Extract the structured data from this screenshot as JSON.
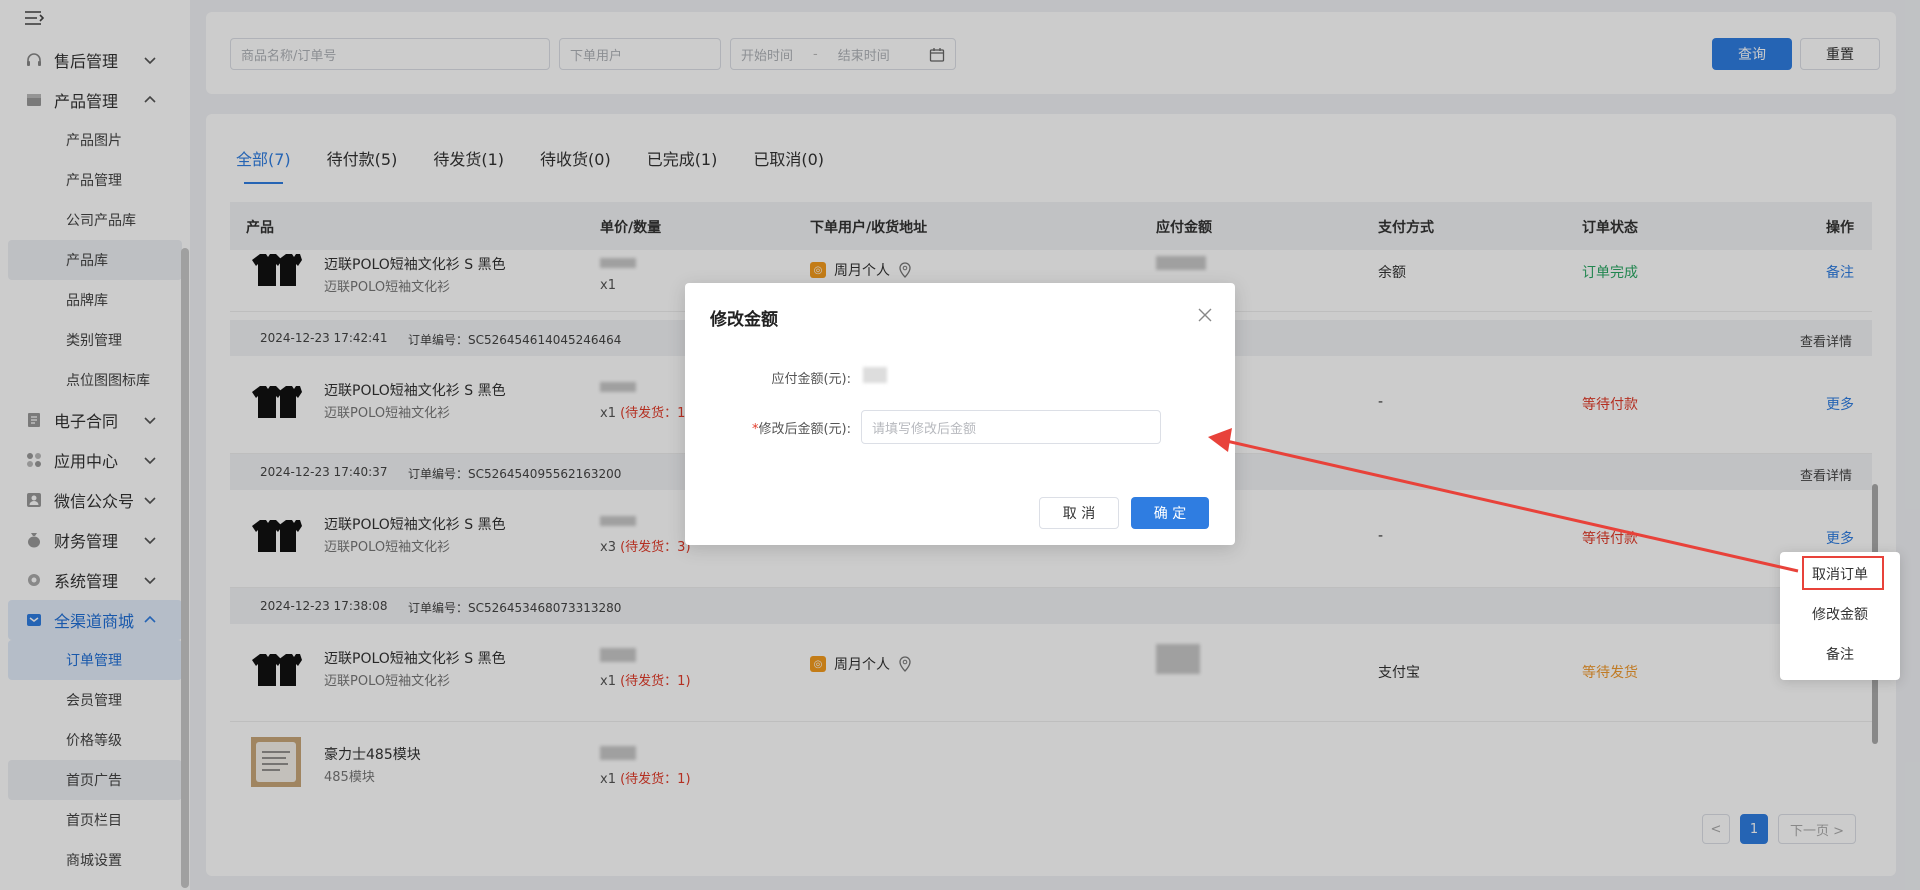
{
  "sidebar": {
    "items": [
      {
        "label": "售后管理",
        "expanded": false
      },
      {
        "label": "产品管理",
        "expanded": true
      },
      {
        "label": "电子合同",
        "expanded": false
      },
      {
        "label": "应用中心",
        "expanded": false
      },
      {
        "label": "微信公众号",
        "expanded": false
      },
      {
        "label": "财务管理",
        "expanded": false
      },
      {
        "label": "系统管理",
        "expanded": false
      },
      {
        "label": "全渠道商城",
        "expanded": true
      }
    ],
    "product_sub": [
      "产品图片",
      "产品管理",
      "公司产品库",
      "产品库",
      "品牌库",
      "类别管理",
      "点位图图标库"
    ],
    "mall_sub": [
      "订单管理",
      "会员管理",
      "价格等级",
      "首页广告",
      "首页栏目",
      "商城设置"
    ]
  },
  "filter": {
    "product_placeholder": "商品名称/订单号",
    "user_placeholder": "下单用户",
    "start_placeholder": "开始时间",
    "date_sep": "-",
    "end_placeholder": "结束时间",
    "query_label": "查询",
    "reset_label": "重置"
  },
  "tabs": [
    "全部(7)",
    "待付款(5)",
    "待发货(1)",
    "待收货(0)",
    "已完成(1)",
    "已取消(0)"
  ],
  "table": {
    "columns": [
      "产品",
      "单价/数量",
      "下单用户/收货地址",
      "应付金额",
      "支付方式",
      "订单状态",
      "操作"
    ],
    "detail_label": "查看详情",
    "orders": [
      {
        "date": "",
        "no": "",
        "product": "迈联POLO短袖文化衫 S 黑色",
        "product_sub": "迈联POLO短袖文化衫",
        "qty": "x1",
        "qty_status": "",
        "user": "周月个人",
        "pay": "余额",
        "status": "订单完成",
        "action": "备注"
      },
      {
        "date": "2024-12-23 17:42:41",
        "no": "订单编号：SC526454614045246464",
        "product": "迈联POLO短袖文化衫 S 黑色",
        "product_sub": "迈联POLO短袖文化衫",
        "qty": "x1",
        "qty_status": "(待发货：1",
        "user": "",
        "pay": "-",
        "status": "等待付款",
        "action": "更多"
      },
      {
        "date": "2024-12-23 17:40:37",
        "no": "订单编号：SC526454095562163200",
        "product": "迈联POLO短袖文化衫 S 黑色",
        "product_sub": "迈联POLO短袖文化衫",
        "qty": "x3",
        "qty_status": "(待发货：3)",
        "user": "",
        "pay": "-",
        "status": "等待付款",
        "action": "更多"
      },
      {
        "date": "2024-12-23 17:38:08",
        "no": "订单编号：SC526453468073313280",
        "product": "迈联POLO短袖文化衫 S 黑色",
        "product_sub": "迈联POLO短袖文化衫",
        "qty": "x1",
        "qty_status": "(待发货：1)",
        "user": "周月个人",
        "pay": "支付宝",
        "status": "等待发货",
        "action": ""
      },
      {
        "date": "",
        "no": "",
        "product": "豪力士485模块",
        "product_sub": "485模块",
        "qty": "x1",
        "qty_status": "(待发货：1)",
        "user": "",
        "pay": "",
        "status": "",
        "action": ""
      }
    ]
  },
  "pager": {
    "prev": "<",
    "current": "1",
    "next": "下一页 >"
  },
  "dialog": {
    "title": "修改金额",
    "amount_label": "应付金额(元):",
    "required_mark": "*",
    "new_amount_label": "修改后金额(元):",
    "new_amount_placeholder": "请填写修改后金额",
    "cancel_label": "取 消",
    "confirm_label": "确 定"
  },
  "dropdown": {
    "items": [
      "取消订单",
      "修改金额",
      "备注"
    ]
  },
  "colors": {
    "primary": "#2f7de1",
    "danger": "#e23b2a",
    "success": "#2ba864",
    "warning": "#f19a2f",
    "annotation": "#e8423a"
  }
}
